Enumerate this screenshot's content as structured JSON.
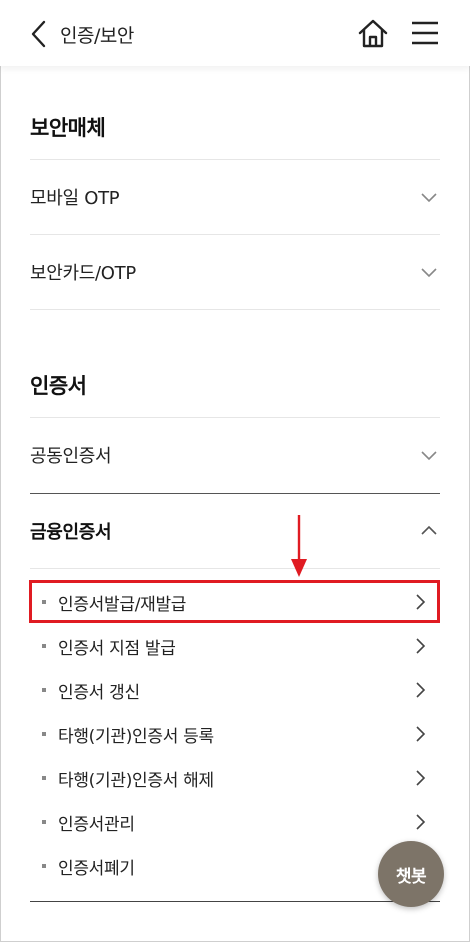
{
  "header": {
    "title": "인증/보안",
    "back_icon": "chevron-left-icon",
    "home_icon": "home-icon",
    "menu_icon": "hamburger-menu-icon"
  },
  "sections": [
    {
      "title": "보안매체",
      "rows": [
        {
          "label": "모바일 OTP",
          "state": "collapsed"
        },
        {
          "label": "보안카드/OTP",
          "state": "collapsed"
        }
      ]
    },
    {
      "title": "인증서",
      "rows": [
        {
          "label": "공동인증서",
          "state": "collapsed"
        },
        {
          "label": "금융인증서",
          "state": "expanded",
          "items": [
            {
              "label": "인증서발급/재발급",
              "highlighted": true
            },
            {
              "label": "인증서 지점 발급"
            },
            {
              "label": "인증서 갱신"
            },
            {
              "label": "타행(기관)인증서 등록"
            },
            {
              "label": "타행(기관)인증서 해제"
            },
            {
              "label": "인증서관리"
            },
            {
              "label": "인증서폐기"
            }
          ]
        }
      ]
    }
  ],
  "chatbot": {
    "label": "챗봇"
  },
  "colors": {
    "highlight": "#e01b22",
    "chatbot_bg": "#7d7468",
    "divider": "#e6e6e6"
  }
}
